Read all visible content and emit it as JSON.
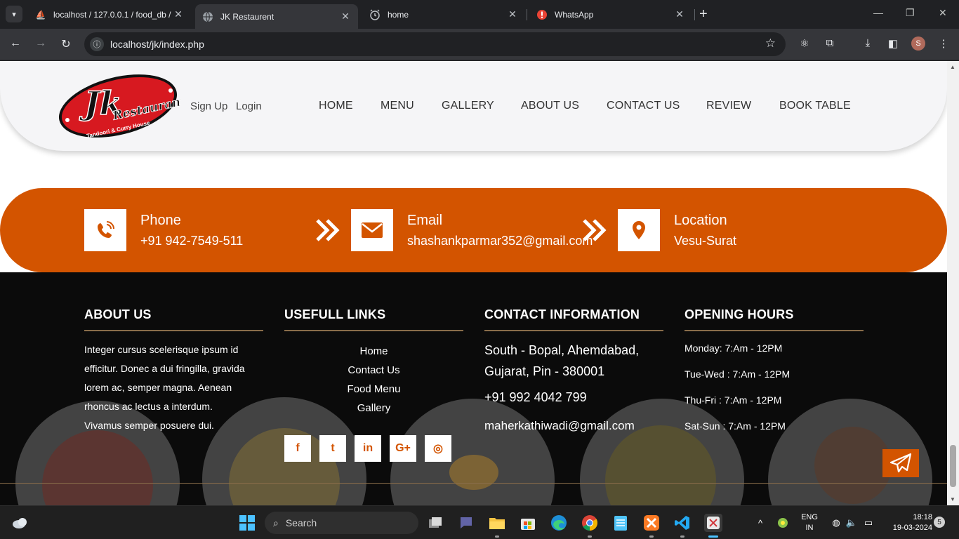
{
  "browser": {
    "tabs": [
      {
        "title": "localhost / 127.0.0.1 / food_db /",
        "favicon": "phpmyadmin-icon"
      },
      {
        "title": "JK Restaurent",
        "favicon": "globe-icon",
        "active": true
      },
      {
        "title": "home",
        "favicon": "clock-icon"
      },
      {
        "title": "WhatsApp",
        "favicon": "alert-icon"
      }
    ],
    "url": "localhost/jk/index.php",
    "profile_initial": "S"
  },
  "header": {
    "logo": {
      "big": "Jk",
      "name": "Restaurant",
      "tagline": "Tandoori & Curry House"
    },
    "auth": {
      "signup": "Sign Up",
      "login": "Login"
    },
    "nav": [
      "HOME",
      "MENU",
      "GALLERY",
      "ABOUT US",
      "CONTACT US",
      "REVIEW",
      "BOOK TABLE"
    ]
  },
  "contact_band": {
    "phone": {
      "title": "Phone",
      "value": "+91 942-7549-511"
    },
    "email": {
      "title": "Email",
      "value": "shashankparmar352@gmail.com"
    },
    "location": {
      "title": "Location",
      "value": "Vesu-Surat"
    },
    "accent_color": "#d35400"
  },
  "footer": {
    "about": {
      "heading": "ABOUT US",
      "lines": [
        "Integer cursus scelerisque ipsum id",
        "efficitur. Donec a dui fringilla, gravida",
        "lorem ac, semper magna. Aenean",
        "rhoncus ac lectus a interdum.",
        "Vivamus semper posuere dui."
      ]
    },
    "links": {
      "heading": "USEFULL LINKS",
      "items": [
        "Home",
        "Contact Us",
        "Food Menu",
        "Gallery"
      ]
    },
    "contact": {
      "heading": "CONTACT INFORMATION",
      "address_line1": "South - Bopal, Ahemdabad,",
      "address_line2": "Gujarat, Pin - 380001",
      "phone": "+91 992 4042 799",
      "email": "maherkathiwadi@gmail.com"
    },
    "hours": {
      "heading": "OPENING HOURS",
      "items": [
        "Monday: 7:Am - 12PM",
        "Tue-Wed : 7:Am - 12PM",
        "Thu-Fri : 7:Am - 12PM",
        "Sat-Sun : 7:Am - 12PM"
      ]
    },
    "social": {
      "facebook": "f",
      "twitter": "t",
      "linkedin": "in",
      "google": "G+",
      "instagram": "◎"
    }
  },
  "taskbar": {
    "search_label": "Search",
    "lang_line1": "ENG",
    "lang_line2": "IN",
    "time": "18:18",
    "date": "19-03-2024",
    "notification_count": "5"
  }
}
